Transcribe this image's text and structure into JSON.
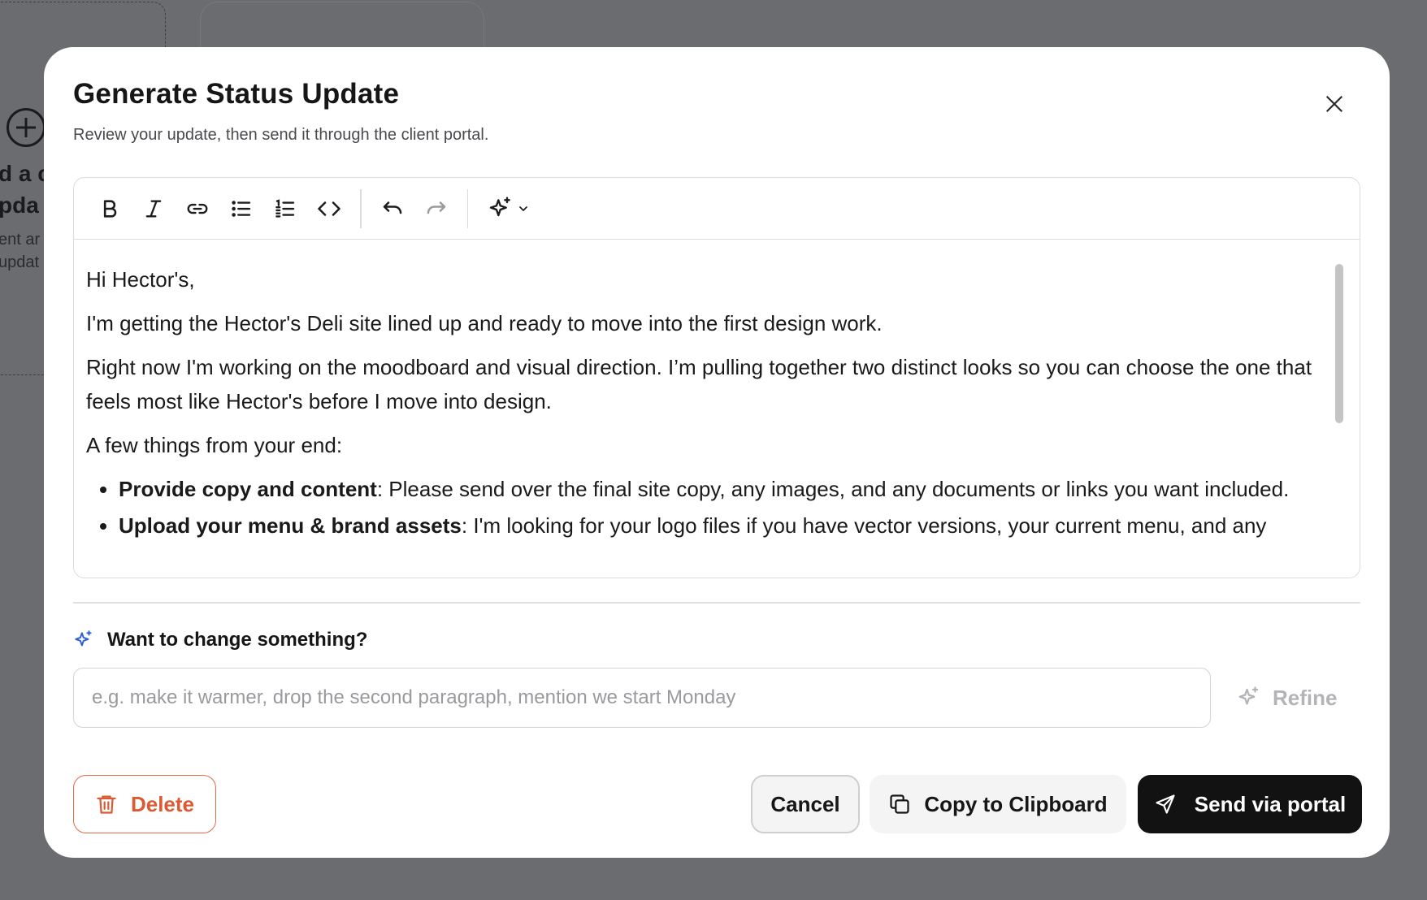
{
  "background": {
    "line1": "d a c",
    "line2": "pda",
    "line3": "ent ar",
    "line4": "updat"
  },
  "modal": {
    "title": "Generate Status Update",
    "subtitle": "Review your update, then send it through the client portal."
  },
  "toolbar": {
    "buttons": [
      "bold-icon",
      "italic-icon",
      "link-icon",
      "bullet-list-icon",
      "numbered-list-icon",
      "code-icon",
      "undo-icon",
      "redo-icon",
      "ai-sparkle-icon",
      "chevron-down-icon"
    ]
  },
  "editor": {
    "greeting": "Hi Hector's,",
    "para1": "I'm getting the Hector's Deli site lined up and ready to move into the first design work.",
    "para2": "Right now I'm working on the moodboard and visual direction. I’m pulling together two distinct looks so you can choose the one that feels most like Hector's before I move into design.",
    "para3": "A few things from your end:",
    "items": [
      {
        "bold": "Provide copy and content",
        "text": ": Please send over the final site copy, any images, and any documents or links you want included."
      },
      {
        "bold": "Upload your menu & brand assets",
        "text": ": I'm looking for your logo files if you have vector versions, your current menu, and any"
      }
    ]
  },
  "refine": {
    "label": "Want to change something?",
    "placeholder": "e.g. make it warmer, drop the second paragraph, mention we start Monday",
    "value": "",
    "button": "Refine"
  },
  "footer": {
    "delete": "Delete",
    "cancel": "Cancel",
    "copy": "Copy to Clipboard",
    "send": "Send via portal"
  },
  "colors": {
    "accent_blue": "#2f5fd0",
    "delete_red": "#dc5a33",
    "send_bg": "#121212"
  }
}
